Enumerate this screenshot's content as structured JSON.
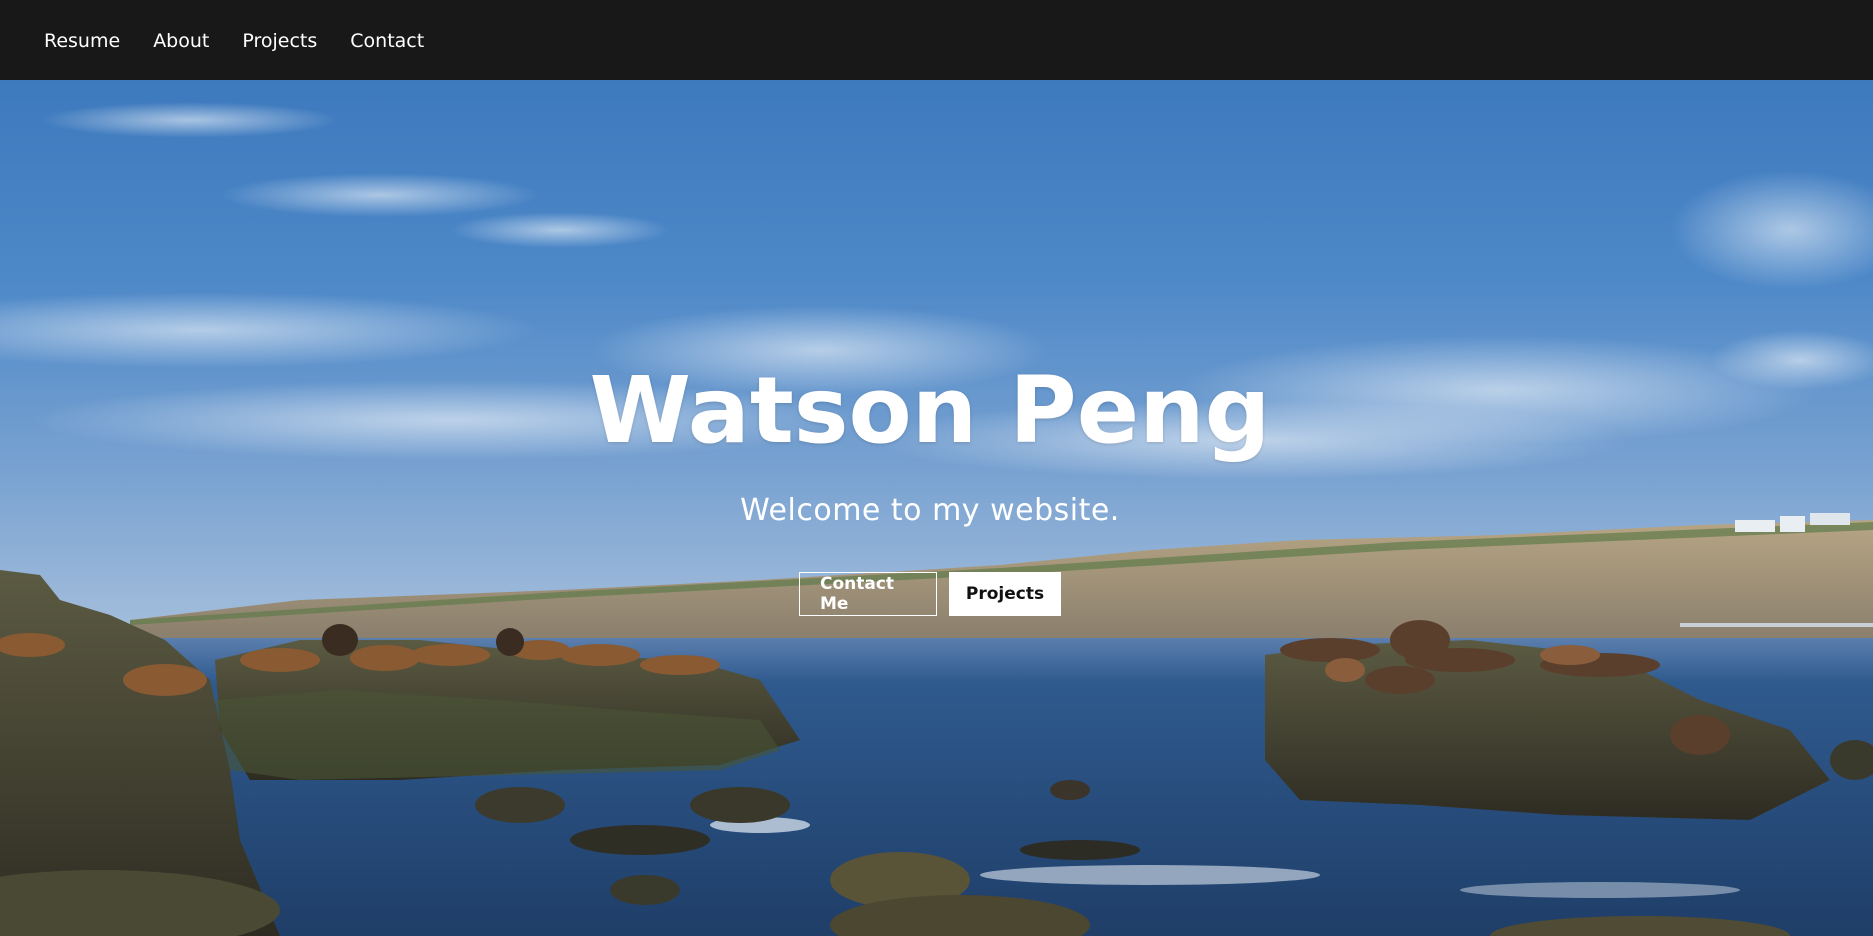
{
  "nav": {
    "items": [
      {
        "label": "Resume"
      },
      {
        "label": "About"
      },
      {
        "label": "Projects"
      },
      {
        "label": "Contact"
      }
    ]
  },
  "hero": {
    "title": "Watson Peng",
    "subtitle": "Welcome to my website.",
    "buttons": {
      "contact_label": "Contact Me",
      "projects_label": "Projects"
    },
    "background": {
      "description_icon": "coastal-sea-lions-photo"
    }
  },
  "colors": {
    "nav_bg": "#181818",
    "sky_top": "#3a78bd",
    "sky_bottom": "#8eb2d8",
    "sea": "#2f5586",
    "rock": "#4a4535",
    "cliff": "#bfae92",
    "text": "#ffffff"
  }
}
